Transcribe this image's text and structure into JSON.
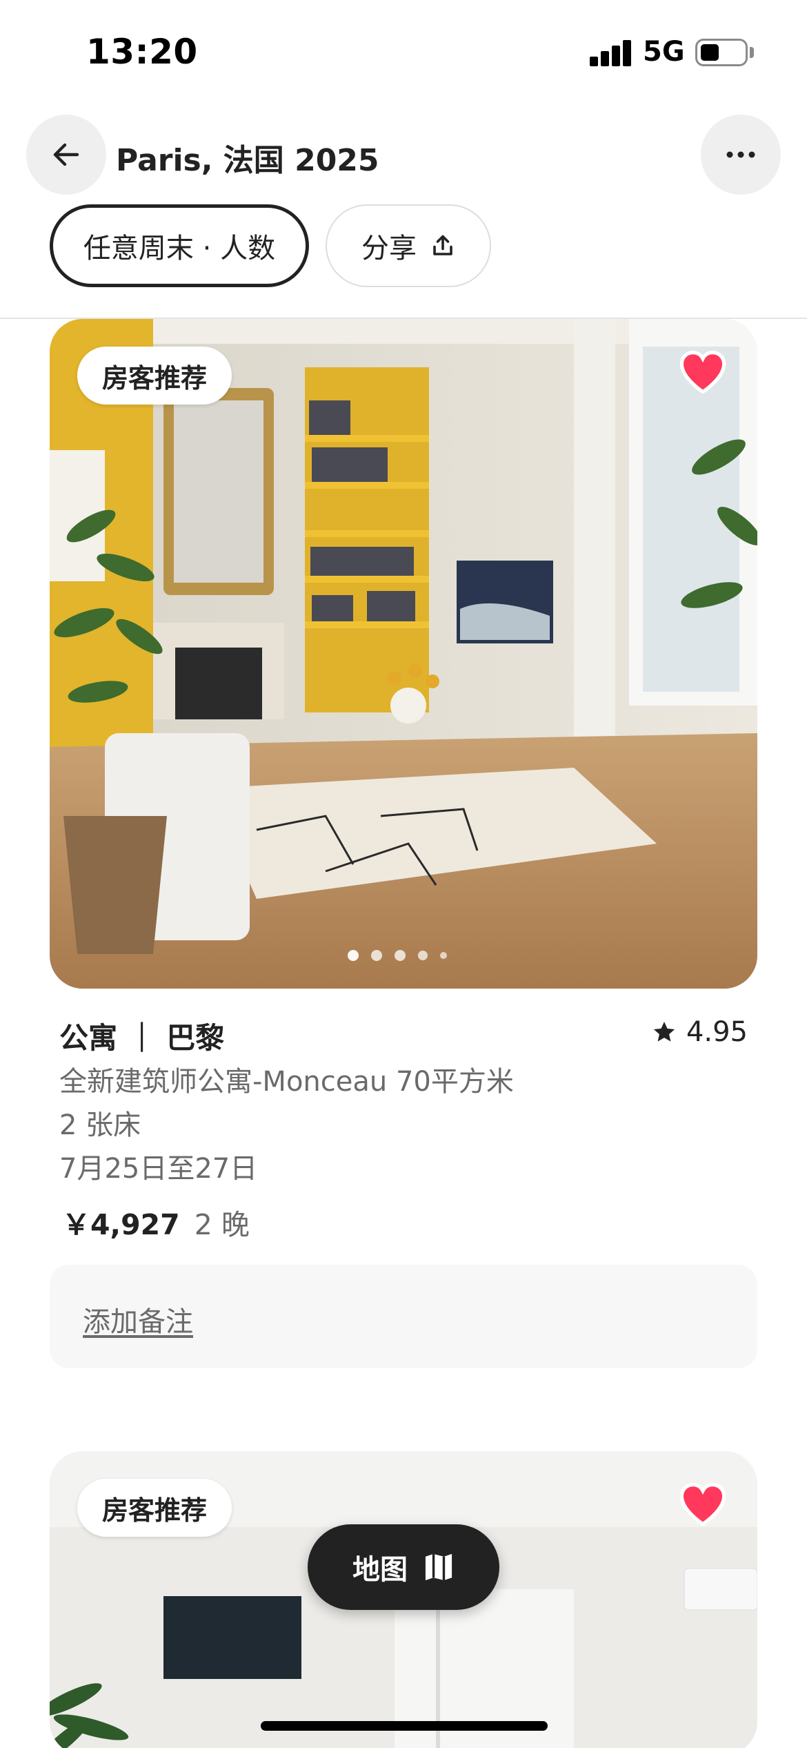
{
  "status_bar": {
    "time": "13:20",
    "network": "5G"
  },
  "header": {
    "title": "Paris, 法国 2025",
    "back_icon": "arrow-left-icon",
    "more_icon": "more-horizontal-icon"
  },
  "filters": {
    "filter_label": "任意周末 · 人数",
    "share_label": "分享",
    "share_icon": "share-upload-icon"
  },
  "listings": [
    {
      "badge": "房客推荐",
      "favorited": true,
      "title": "公寓 ｜ 巴黎",
      "rating": "4.95",
      "subtitle": "全新建筑师公寓-Monceau 70平方米",
      "beds": "2 张床",
      "dates": "7月25日至27日",
      "price": "￥4,927",
      "nights": "2 晚",
      "photo_count_dots": 5,
      "active_photo": 0
    },
    {
      "badge": "房客推荐",
      "favorited": true
    }
  ],
  "note": {
    "label": "添加备注"
  },
  "map_button": {
    "label": "地图",
    "icon": "map-icon"
  },
  "colors": {
    "heart": "#ff385c",
    "text_primary": "#222222",
    "text_secondary": "#6a6a6a",
    "map_button_bg": "#222222",
    "note_bg": "#f7f7f7"
  }
}
